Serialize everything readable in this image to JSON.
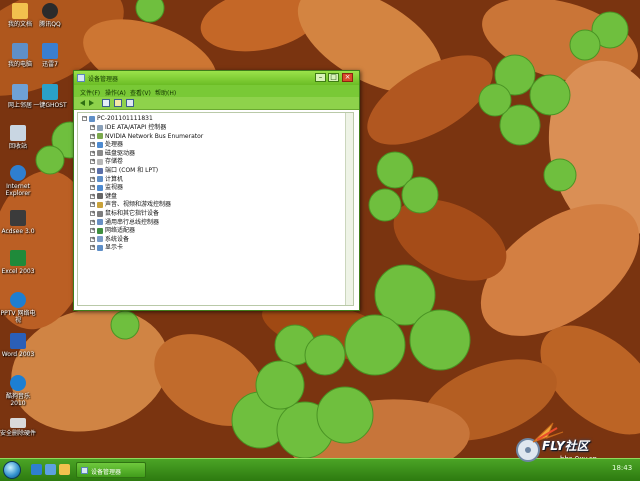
{
  "desktop": {
    "icons": [
      {
        "label": "我的文档",
        "icon": "folder-documents-icon",
        "color": "#f2c14e"
      },
      {
        "label": "腾讯QQ",
        "icon": "qq-penguin-icon",
        "color": "#2b2b2b"
      },
      {
        "label": "我的电脑",
        "icon": "computer-icon",
        "color": "#5f8fc7"
      },
      {
        "label": "迅雷7",
        "icon": "thunder-bird-icon",
        "color": "#3a7fd1"
      },
      {
        "label": "网上邻居",
        "icon": "network-icon",
        "color": "#6fa1d6"
      },
      {
        "label": "一键GHOST",
        "icon": "ghost-icon",
        "color": "#2aa1c9"
      },
      {
        "label": "回收站",
        "icon": "recycle-bin-icon",
        "color": "#c9d6e2"
      },
      {
        "label": "Internet Explorer",
        "icon": "ie-icon",
        "color": "#2f7fd0"
      },
      {
        "label": "Acdsee 3.0",
        "icon": "acdsee-icon",
        "color": "#3b3b3b"
      },
      {
        "label": "Excel 2003",
        "icon": "excel-icon",
        "color": "#1f8a3a"
      },
      {
        "label": "PPTV 网络电视",
        "icon": "pptv-icon",
        "color": "#1e7ed0"
      },
      {
        "label": "Word 2003",
        "icon": "word-icon",
        "color": "#2b5fb8"
      },
      {
        "label": "酷狗音乐 2010",
        "icon": "kugou-icon",
        "color": "#1c7fd3"
      },
      {
        "label": "安全删除硬件",
        "icon": "safely-remove-hardware-icon",
        "color": "#d9d9d9"
      }
    ]
  },
  "window": {
    "title": "设备管理器",
    "controls": {
      "minimize": "–",
      "maximize": "□",
      "close": "×"
    },
    "menu": [
      "文件(F)",
      "操作(A)",
      "查看(V)",
      "帮助(H)"
    ],
    "toolbar_icons": [
      "back-icon",
      "forward-icon",
      "properties-icon",
      "help-icon",
      "scan-icon",
      "update-driver-icon"
    ],
    "tree": {
      "root": "PC-201101111831",
      "items": [
        "IDE ATA/ATAPI 控制器",
        "NVIDIA Network Bus Enumerator",
        "处理器",
        "磁盘驱动器",
        "存储卷",
        "端口 (COM 和 LPT)",
        "计算机",
        "监视器",
        "键盘",
        "声音、视频和游戏控制器",
        "鼠标和其它指针设备",
        "通用串行总线控制器",
        "网络适配器",
        "系统设备",
        "显示卡"
      ]
    },
    "colors": {
      "titlebar": "#7ccb33",
      "menubar": "#79c936"
    }
  },
  "taskbar": {
    "quick_launch": [
      "show-desktop-icon",
      "ie-quick-icon",
      "explorer-quick-icon"
    ],
    "task_label": "设备管理器",
    "clock": "18:43"
  },
  "logo": {
    "brand": "FLY社区",
    "url": "bbs.0xy.cn"
  }
}
